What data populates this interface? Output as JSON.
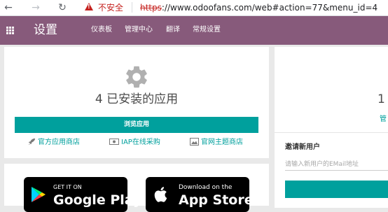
{
  "browser": {
    "security_label": "不安全",
    "url_scheme": "https",
    "url_rest": "://www.odoofans.com/web#action=77&menu_id=4"
  },
  "topbar": {
    "title": "设置",
    "menu": [
      "仪表板",
      "管理中心",
      "翻译",
      "常规设置"
    ]
  },
  "apps_card": {
    "count_text": "4 已安装的应用",
    "browse_button": "浏览应用",
    "links": [
      "官方应用商店",
      "IAP在线采购",
      "官网主题商店"
    ]
  },
  "stores": {
    "google": {
      "small": "GET IT ON",
      "big": "Google Play"
    },
    "apple": {
      "small": "Download on the",
      "big": "App Store"
    }
  },
  "users_card": {
    "count_text": "1",
    "link_text": "管",
    "invite_title": "邀请新用户",
    "invite_placeholder": "请输入新用户的EMail地址"
  },
  "colors": {
    "brand": "#875a7b",
    "accent": "#00a09d",
    "insecure": "#c5221f"
  }
}
